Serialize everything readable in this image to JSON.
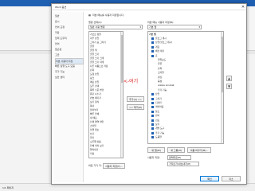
{
  "dialog": {
    "title": "Word 옵션",
    "close_glyph": "✕",
    "header_text": "리본 메뉴를 사용자 지정합니다.",
    "nav_items": [
      {
        "label": "일반"
      },
      {
        "label": "표시"
      },
      {
        "label": "언어 교정"
      },
      {
        "label": "저장"
      },
      {
        "label": "입력 도우미"
      },
      {
        "label": "언어"
      },
      {
        "label": "접근성"
      },
      {
        "label": "고급"
      },
      {
        "label": "리본 사용자 지정"
      },
      {
        "label": "빠른 실행 도구 모음"
      },
      {
        "label": "추가 기능"
      },
      {
        "label": "보안 센터"
      }
    ],
    "selected_nav": "리본 사용자 지정",
    "left_label": "명령 선택(C):",
    "left_dropdown": "일반 사용 명령",
    "right_label": "리본 메뉴 사용자 지정(B):",
    "right_dropdown": "기본 탭",
    "add_button": "추가(A) >>",
    "remove_button": "<< 제거(R)",
    "commands": [
      "가로로 정렬",
      "각주 삽입",
      "그리기 표 그리기",
      "글꼴",
      "글꼴 색",
      "글꼴 크기",
      "글꼴 크기 크게",
      "글꼴 크기 작게",
      "다른 이름으로 저장",
      "단락",
      "도형 삽입",
      "링크",
      "메모 삽입",
      "모두 선택",
      "목록 수준 변경",
      "문단 나누기",
      "번호 매기기",
      "보기 형식",
      "복사",
      "붙여넣기",
      "빠른 인쇄",
      "새 메모",
      "선택 영역 확인",
      "스타일",
      "실행 취소",
      "쓰기",
      "열기",
      "오른쪽 맞춤",
      "인쇄 미리 보기",
      "잘라내기",
      "저장"
    ],
    "tree_root": "기본 탭",
    "tree": [
      {
        "label": "블로그 게시",
        "checked": true
      },
      {
        "label": "삽입(블로그 게시)",
        "checked": true
      },
      {
        "label": "개요",
        "checked": true
      },
      {
        "label": "배경 제거",
        "checked": true
      },
      {
        "label": "홈",
        "checked": true
      },
      {
        "label": "클립보드",
        "checked": false
      },
      {
        "label": "글꼴",
        "checked": false
      },
      {
        "label": "단락",
        "checked": false
      },
      {
        "label": "스타일",
        "checked": false
      },
      {
        "label": "편집",
        "checked": false
      },
      {
        "label": "음성",
        "checked": false
      },
      {
        "label": "Adobe Acrobat",
        "checked": false
      },
      {
        "label": "추가 기능",
        "checked": false
      },
      {
        "label": "삽입",
        "checked": true
      },
      {
        "label": "그리기",
        "checked": true
      },
      {
        "label": "디자인",
        "checked": true
      },
      {
        "label": "레이아웃",
        "checked": true
      },
      {
        "label": "참조",
        "checked": true
      },
      {
        "label": "편지",
        "checked": true
      },
      {
        "label": "검토",
        "checked": true
      },
      {
        "label": "보기",
        "checked": true
      },
      {
        "label": "개발 도구",
        "checked": true
      },
      {
        "label": "추가 기능",
        "checked": true
      },
      {
        "label": "도움말",
        "checked": true
      }
    ],
    "new_tab_button": "새 탭(W)",
    "new_group_button": "새 그룹(N)",
    "rename_button": "이름 바꾸기(M)...",
    "custom_label": "사용자 지정:",
    "reset_dropdown": "원래대로(E)",
    "import_export_dropdown": "가져오기/내보내기(P)",
    "keyboard_label": "바로 가기 키:",
    "keyboard_button": "사용자 지정(T)...",
    "ok_button": "확인",
    "cancel_button": "취소"
  },
  "annotation": {
    "text": "<-여기"
  },
  "word": {
    "status_text": "1/1 페이지"
  },
  "colors": {
    "accent": "#1f5fb2",
    "annotation": "#d9231f"
  }
}
